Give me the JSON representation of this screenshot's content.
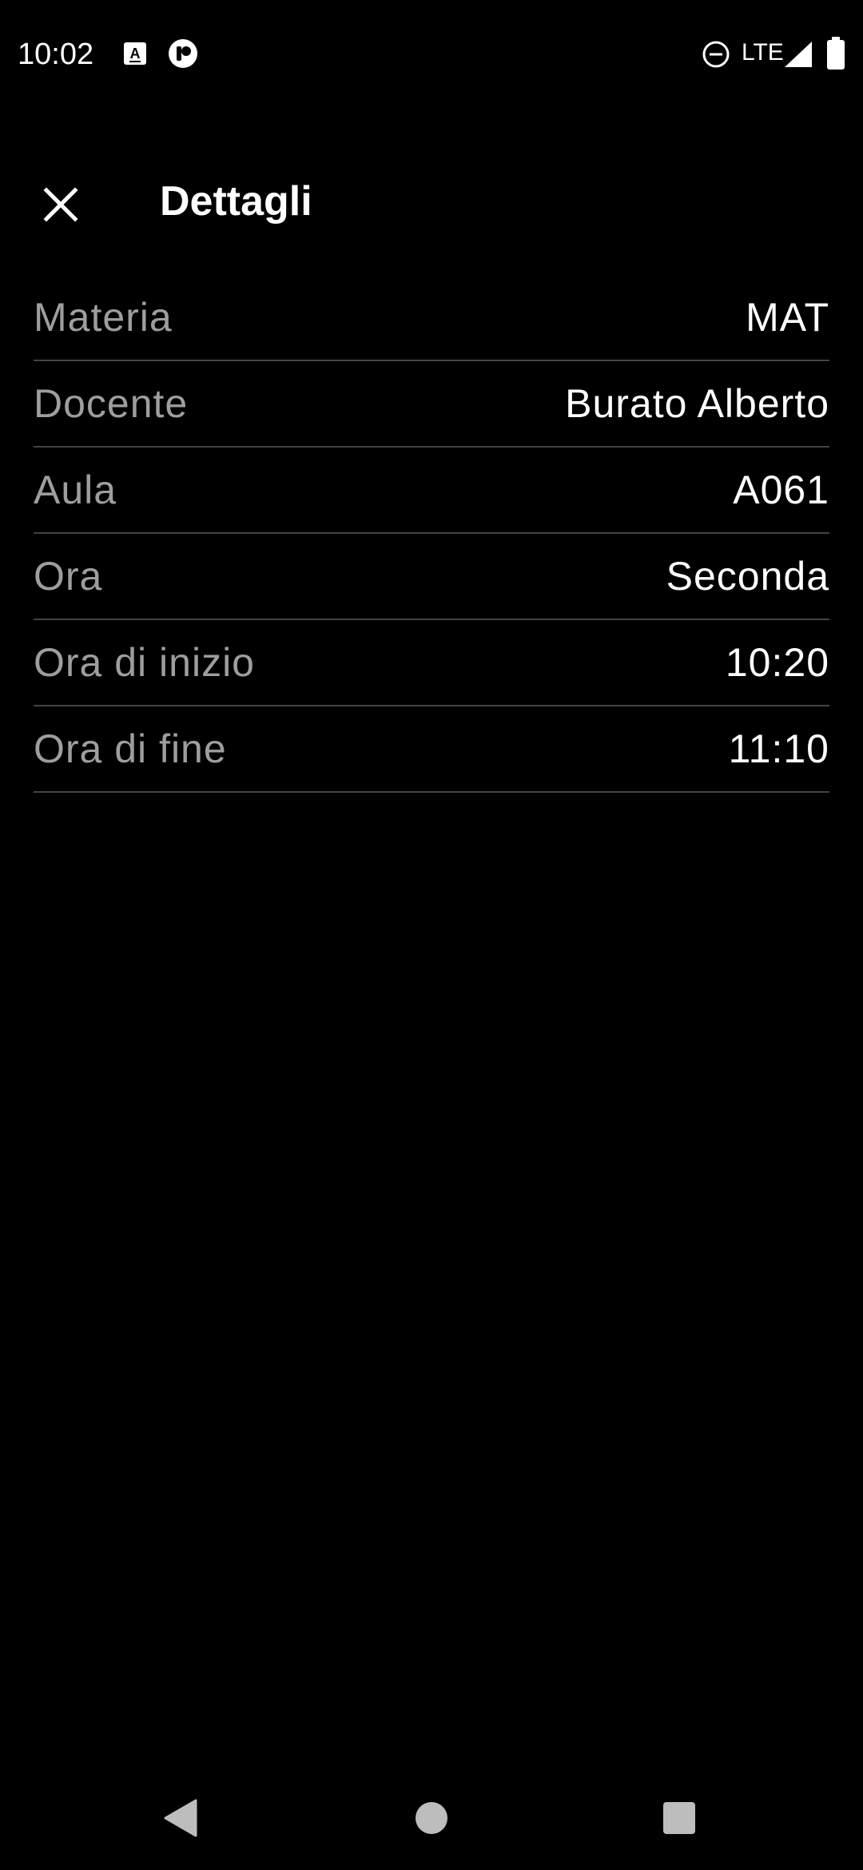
{
  "status_bar": {
    "time": "10:02",
    "network": "LTE",
    "icons": [
      "text-a-icon",
      "app-notification-icon",
      "do-not-disturb-icon",
      "signal-icon",
      "battery-icon"
    ]
  },
  "app_bar": {
    "title": "Dettagli",
    "close_icon": "close-icon"
  },
  "details": [
    {
      "label": "Materia",
      "value": "MAT"
    },
    {
      "label": "Docente",
      "value": "Burato Alberto"
    },
    {
      "label": "Aula",
      "value": "A061"
    },
    {
      "label": "Ora",
      "value": "Seconda"
    },
    {
      "label": "Ora di inizio",
      "value": "10:20"
    },
    {
      "label": "Ora di fine",
      "value": "11:10"
    }
  ],
  "nav_bar": {
    "icons": [
      "back-icon",
      "home-icon",
      "recents-icon"
    ]
  },
  "colors": {
    "background": "#000000",
    "label": "#9e9e9e",
    "value": "#ffffff",
    "divider": "#444444",
    "nav_icon": "#bdbdbd"
  }
}
